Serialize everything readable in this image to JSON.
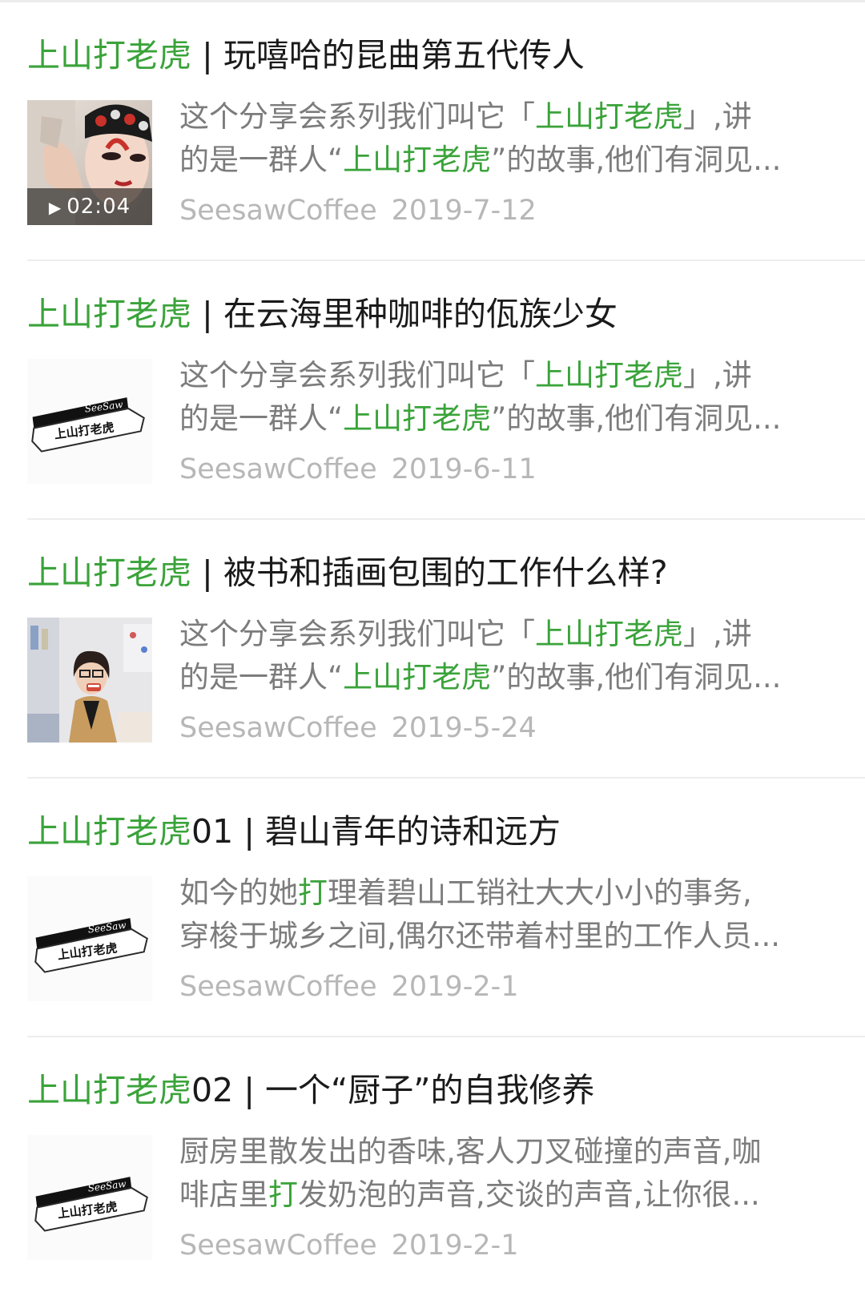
{
  "colors": {
    "accent": "#3aa33a",
    "title": "#1a1a1a",
    "snippet": "#7c7c7c",
    "meta": "#b7b7b7"
  },
  "articles": [
    {
      "title_hl": "上山打老虎",
      "title_rest": " | 玩嘻哈的昆曲第五代传人",
      "line1_a": "这个分享会系列我们叫它「",
      "line1_hl": "上山打老虎",
      "line1_b": "」,讲",
      "line2_a": "的是一群人“",
      "line2_hl": "上山打老虎",
      "line2_b": "”的故事,他们有洞见...",
      "source": "SeesawCoffee",
      "date": "2019-7-12",
      "thumb": "opera-performer-photo",
      "duration": "02:04"
    },
    {
      "title_hl": "上山打老虎",
      "title_rest": " | 在云海里种咖啡的佤族少女",
      "line1_a": "这个分享会系列我们叫它「",
      "line1_hl": "上山打老虎",
      "line1_b": "」,讲",
      "line2_a": "的是一群人“",
      "line2_hl": "上山打老虎",
      "line2_b": "”的故事,他们有洞见...",
      "source": "SeesawCoffee",
      "date": "2019-6-11",
      "thumb": "seesaw-logo",
      "logo_script": "SeeSaw",
      "logo_text": "上山打老虎"
    },
    {
      "title_hl": "上山打老虎",
      "title_rest": " | 被书和插画包围的工作什么样?",
      "line1_a": "这个分享会系列我们叫它「",
      "line1_hl": "上山打老虎",
      "line1_b": "」,讲",
      "line2_a": "的是一群人“",
      "line2_hl": "上山打老虎",
      "line2_b": "”的故事,他们有洞见...",
      "source": "SeesawCoffee",
      "date": "2019-5-24",
      "thumb": "illustrator-portrait-photo"
    },
    {
      "title_hl": "上山打老虎",
      "title_rest": "01 | 碧山青年的诗和远方",
      "line1_a": "如今的她",
      "line1_hl": "打",
      "line1_b": "理着碧山工销社大大小小的事务,",
      "line2_a": "穿梭于城乡之间,偶尔还带着村里的工作人员...",
      "line2_hl": "",
      "line2_b": "",
      "source": "SeesawCoffee",
      "date": "2019-2-1",
      "thumb": "seesaw-logo",
      "logo_script": "SeeSaw",
      "logo_text": "上山打老虎"
    },
    {
      "title_hl": "上山打老虎",
      "title_rest": "02 | 一个“厨子”的自我修养",
      "line1_a": "厨房里散发出的香味,客人刀叉碰撞的声音,咖",
      "line1_hl": "",
      "line1_b": "",
      "line2_a": "啡店里",
      "line2_hl": "打",
      "line2_b": "发奶泡的声音,交谈的声音,让你很...",
      "source": "SeesawCoffee",
      "date": "2019-2-1",
      "thumb": "seesaw-logo",
      "logo_script": "SeeSaw",
      "logo_text": "上山打老虎"
    }
  ]
}
